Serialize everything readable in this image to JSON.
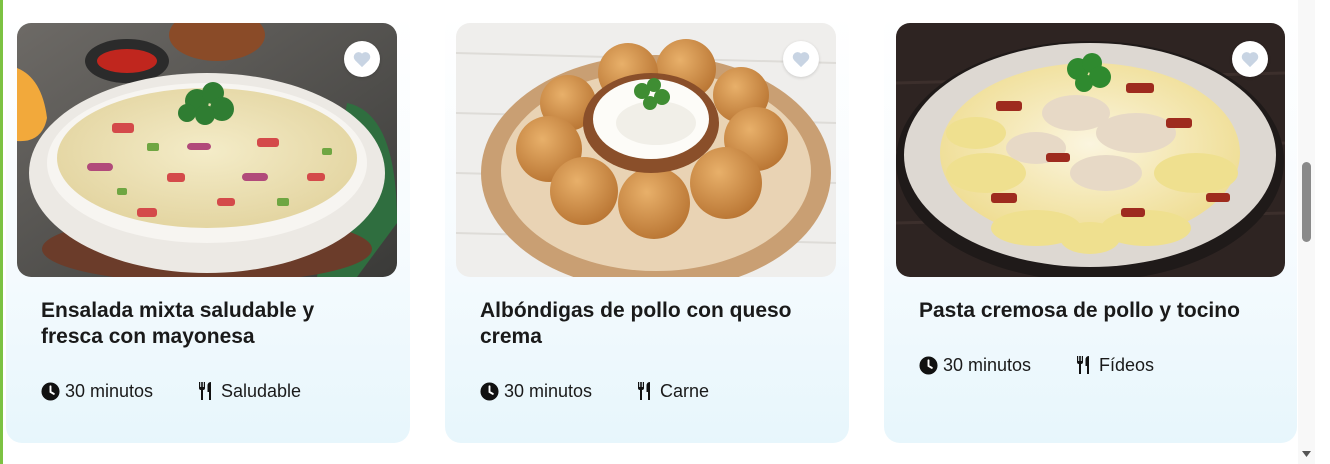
{
  "cards": [
    {
      "title": "Ensalada mixta saludable y fresca con mayonesa",
      "time": "30 minutos",
      "category": "Saludable",
      "image": "creamy macaroni salad in white bowl with parsley"
    },
    {
      "title": "Albóndigas de pollo con queso crema",
      "time": "30 minutos",
      "category": "Carne",
      "image": "fried chicken balls around a bowl of cream dip"
    },
    {
      "title": "Pasta cremosa de pollo y tocino",
      "time": "30 minutos",
      "category": "Fídeos",
      "image": "creamy pasta with chicken, bacon and parsley"
    }
  ],
  "icons": {
    "favorite": "heart-icon",
    "time": "clock-icon",
    "category": "utensils-icon"
  },
  "colors": {
    "accent_green": "#7cc242",
    "card_bg_bottom": "#e7f6fc",
    "heart": "#c8d4e3"
  }
}
